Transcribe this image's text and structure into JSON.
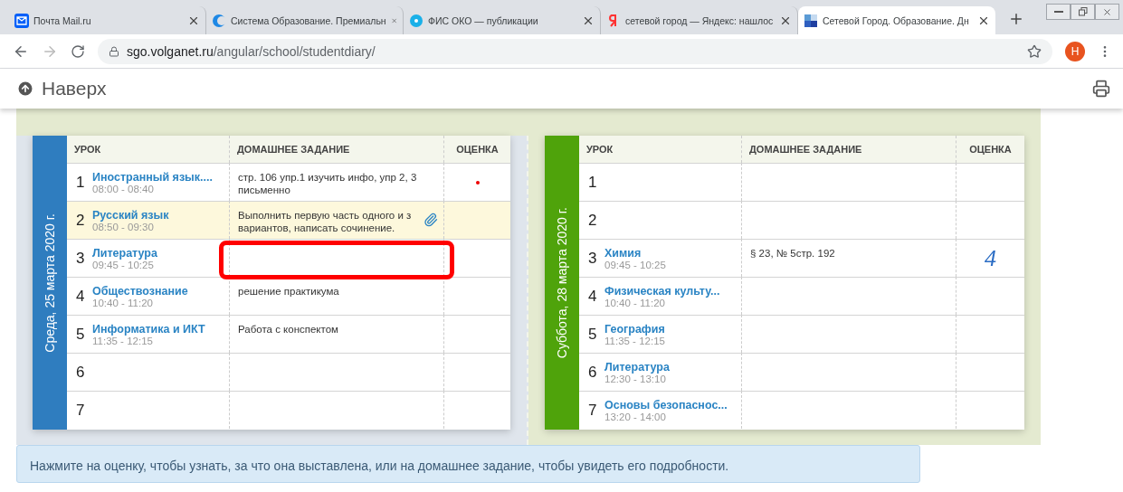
{
  "browser": {
    "tabs": [
      {
        "title": "Почта Mail.ru",
        "selected": false
      },
      {
        "title": "Система Образование. Премиальн",
        "selected": false
      },
      {
        "title": "ФИС ОКО — публикации",
        "selected": false
      },
      {
        "title": "сетевой город — Яндекс: нашлос",
        "selected": false
      },
      {
        "title": "Сетевой Город. Образование. Дн",
        "selected": true
      }
    ],
    "address": {
      "host": "sgo.volganet.ru",
      "path": "/angular/school/studentdiary/"
    },
    "avatar": "Н"
  },
  "page": {
    "back_to_top": "Наверх",
    "days": [
      {
        "label": "Среда, 25 марта 2020 г.",
        "color": "#2f7dbf",
        "current_week": true,
        "columns": [
          "УРОК",
          "ДОМАШНЕЕ ЗАДАНИЕ",
          "ОЦЕНКА"
        ],
        "lessons": [
          {
            "number": "1",
            "subject": "Иностранный язык....",
            "time": "08:00 - 08:40",
            "homework": "стр. 106 упр.1 изучить инфо, упр 2, 3 письменно",
            "overdue_dot": true,
            "attachment": false,
            "highlighted": false,
            "framed": false
          },
          {
            "number": "2",
            "subject": "Русский язык",
            "time": "08:50 - 09:30",
            "homework": "Выполнить первую часть одного и з вариантов, написать сочинение.",
            "overdue_dot": false,
            "attachment": true,
            "highlighted": true,
            "framed": false
          },
          {
            "number": "3",
            "subject": "Литература",
            "time": "09:45 - 10:25",
            "overdue_dot": false,
            "attachment": false,
            "highlighted": false,
            "framed": true
          },
          {
            "number": "4",
            "subject": "Обществознание",
            "time": "10:40 - 11:20",
            "homework": "решение практикума",
            "overdue_dot": false,
            "attachment": false,
            "highlighted": false,
            "framed": false
          },
          {
            "number": "5",
            "subject": "Информатика и ИКТ",
            "time": "11:35 - 12:15",
            "homework": "Работа с конспектом",
            "overdue_dot": false,
            "attachment": false,
            "highlighted": false,
            "framed": false
          },
          {
            "number": "6",
            "overdue_dot": false,
            "attachment": false,
            "highlighted": false,
            "framed": false
          },
          {
            "number": "7",
            "overdue_dot": false,
            "attachment": false,
            "highlighted": false,
            "framed": false
          }
        ]
      },
      {
        "label": "Суббота, 28 марта 2020 г.",
        "color": "#4fa30b",
        "current_week": false,
        "columns": [
          "УРОК",
          "ДОМАШНЕЕ ЗАДАНИЕ",
          "ОЦЕНКА"
        ],
        "lessons": [
          {
            "number": "1",
            "overdue_dot": false,
            "attachment": false,
            "highlighted": false,
            "framed": false
          },
          {
            "number": "2",
            "overdue_dot": false,
            "attachment": false,
            "highlighted": false,
            "framed": false
          },
          {
            "number": "3",
            "subject": "Химия",
            "time": "09:45 - 10:25",
            "homework": "§ 23, № 5стр. 192",
            "grade": "4",
            "overdue_dot": false,
            "attachment": false,
            "highlighted": false,
            "framed": false
          },
          {
            "number": "4",
            "subject": "Физическая культу...",
            "time": "10:40 - 11:20",
            "overdue_dot": false,
            "attachment": false,
            "highlighted": false,
            "framed": false
          },
          {
            "number": "5",
            "subject": "География",
            "time": "11:35 - 12:15",
            "overdue_dot": false,
            "attachment": false,
            "highlighted": false,
            "framed": false
          },
          {
            "number": "6",
            "subject": "Литература",
            "time": "12:30 - 13:10",
            "overdue_dot": false,
            "attachment": false,
            "highlighted": false,
            "framed": false
          },
          {
            "number": "7",
            "subject": "Основы безопаснос...",
            "time": "13:20 - 14:00",
            "overdue_dot": false,
            "attachment": false,
            "highlighted": false,
            "framed": false
          }
        ]
      }
    ],
    "hint": "Нажмите на оценку, чтобы узнать, за что она выставлена, или на домашнее задание, чтобы увидеть его подробности."
  }
}
